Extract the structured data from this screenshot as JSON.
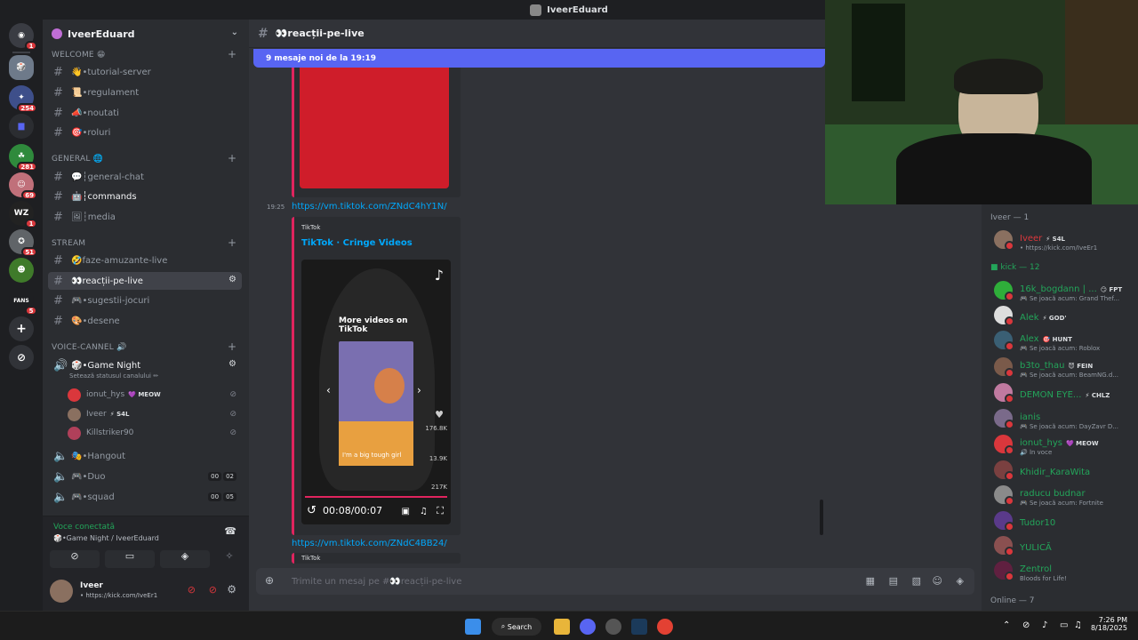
{
  "window": {
    "title": "IveerEduard"
  },
  "servers": [
    {
      "label": "D",
      "badge": "1",
      "color": "#5865f2"
    },
    {
      "label": "",
      "badge": "",
      "color": "#6e7a8a"
    },
    {
      "label": "",
      "badge": "254",
      "color": "#3e4f8a"
    },
    {
      "label": "",
      "badge": "",
      "color": "#5865f2"
    },
    {
      "label": "",
      "badge": "281",
      "color": "#2f8a3c"
    },
    {
      "label": "",
      "badge": "69",
      "color": "#c0707a"
    },
    {
      "label": "WZ",
      "badge": "1",
      "color": "#222"
    },
    {
      "label": "",
      "badge": "51",
      "color": "#606468"
    },
    {
      "label": "",
      "badge": "",
      "color": "#3f7a2a"
    },
    {
      "label": "FANS",
      "badge": "5",
      "color": "#1e1f22"
    }
  ],
  "guild": {
    "name": "IveerEduard"
  },
  "categories": {
    "welcome": "WELCOME 😁",
    "general": "GENERAL 🌐",
    "stream": "STREAM",
    "voice": "VOICE-CANNEL 🔊"
  },
  "channels": {
    "tutorial": "👋•tutorial-server",
    "regulament": "📜•regulament",
    "noutati": "📣•noutati",
    "roluri": "🎯•roluri",
    "general_chat": "💬┆general-chat",
    "commands": "🤖┆commands",
    "media": "🖼┆media",
    "faze": "🤣faze-amuzante-live",
    "reactii": "👀reacții-pe-live",
    "sugestii": "🎮•sugestii-jocuri",
    "desene": "🎨•desene"
  },
  "voice_channels": {
    "game_night": "🎲•Game Night",
    "game_night_status": "Setează statusul canalului ✏",
    "hangout": "🎭•Hangout",
    "duo": "🎮•Duo",
    "squad": "🎮•squad",
    "duo_count": [
      "00",
      "02"
    ],
    "squad_count": [
      "00",
      "05"
    ]
  },
  "voice_users": [
    {
      "name": "ionut_hys",
      "tag": "💜 MEOW",
      "color": "#da373c"
    },
    {
      "name": "Iveer",
      "tag": "⚡ S4L",
      "color": "#8a7060"
    },
    {
      "name": "Killstriker90",
      "tag": "",
      "color": "#b0405a"
    }
  ],
  "voice_panel": {
    "status": "Voce conectată",
    "location": "🎲•Game Night / IveerEduard"
  },
  "user_panel": {
    "name": "Iveer",
    "status": "• https://kick.com/IveEr1"
  },
  "chat": {
    "channel": "👀reacții-pe-live",
    "new_messages": "9 mesaje noi de la 19:19",
    "msg_time": "19:25",
    "link1": "https://vm.tiktok.com/ZNdC4hY1N/",
    "provider": "TikTok",
    "embed_title": "TikTok · Cringe Videos",
    "video_overlay": "More videos on TikTok",
    "video_caption": "I'm a big tough girl",
    "likes": "176.8K",
    "comments": "13.9K",
    "shares": "217K",
    "time_display": "00:08/00:07",
    "link2": "https://vm.tiktok.com/ZNdC4BB24/",
    "provider2": "TikTok",
    "composer_placeholder": "Trimite un mesaj pe #👀reacții-pe-live"
  },
  "members": {
    "group1": "Iveer — 1",
    "group2": "kick — 12",
    "group3": "Online — 7",
    "list1": [
      {
        "name": "Iveer",
        "tag": "⚡ S4L",
        "status": "• https://kick.com/IveEr1",
        "color": "#8a7060",
        "name_color": "#da373c"
      }
    ],
    "list2": [
      {
        "name": "16k_bogdann | ...",
        "tag": "😏 FPT",
        "status": "🎮 Se joacă acum: Grand Thef...",
        "color": "#2fae3a"
      },
      {
        "name": "Alek",
        "tag": "⚡ GOD'",
        "status": "",
        "color": "#dddddd"
      },
      {
        "name": "Alex",
        "tag": "🎯 HUNT",
        "status": "🎮 Se joacă acum: Roblox",
        "color": "#3a5f74"
      },
      {
        "name": "b3to_thau",
        "tag": "😈 FEIN",
        "status": "🎮 Se joacă acum: BeamNG.d...",
        "color": "#7a5a4a"
      },
      {
        "name": "DEMON EYE...",
        "tag": "⚡ CHLZ",
        "status": "",
        "color": "#c07aa0"
      },
      {
        "name": "ianis",
        "tag": "",
        "status": "🎮 Se joacă acum: DayZavr D...",
        "color": "#7a6a8a"
      },
      {
        "name": "ionut_hys",
        "tag": "💜 MEOW",
        "status": "🔊 În voce",
        "color": "#da373c"
      },
      {
        "name": "Khidir_KaraWita",
        "tag": "",
        "status": "",
        "color": "#7a4040"
      },
      {
        "name": "raducu budnar",
        "tag": "",
        "status": "🎮 Se joacă acum: Fortnite",
        "color": "#8a8a8a"
      },
      {
        "name": "Tudor10",
        "tag": "",
        "status": "",
        "color": "#5a3a8a"
      },
      {
        "name": "YULICĂ",
        "tag": "",
        "status": "",
        "color": "#8a5050"
      },
      {
        "name": "Zentrol",
        "tag": "",
        "status": "Bloods for Life!",
        "color": "#602040"
      }
    ]
  },
  "taskbar": {
    "search": "Search",
    "time": "7:26 PM",
    "date": "8/18/2025"
  }
}
